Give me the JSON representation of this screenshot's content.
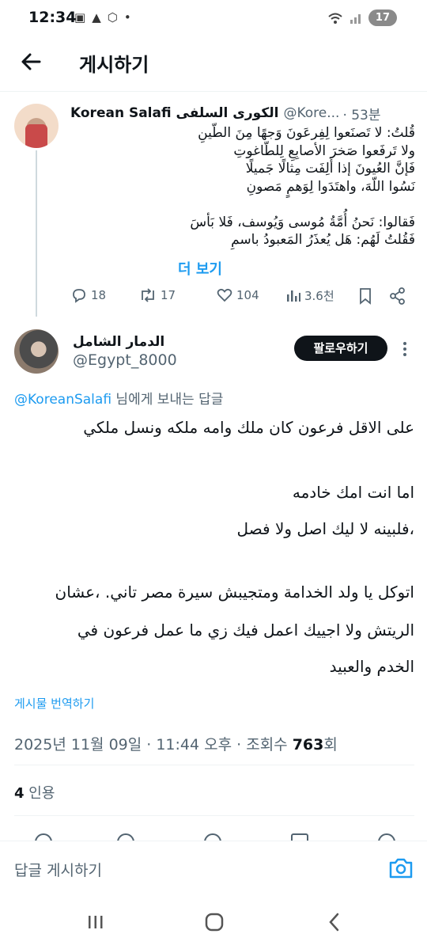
{
  "status_bar": {
    "time": "12:34",
    "battery": "17"
  },
  "header": {
    "title": "게시하기"
  },
  "original_tweet": {
    "name": "Korean Salafi الكورى السلفى",
    "handle": "@Kore...",
    "time": "· 53분",
    "body_lines": [
      "قُلتُ: لا تَصنَعوا لِفِرعَونَ وَجهًا مِنَ الطّينِ",
      "ولا تَرفَعوا صَخرَ الأصابِعِ لِلطّاغوتِ",
      "فَإنَّ العُيونَ إذا أَلِفَت مِثالًا جَميلًا",
      "نَسُوا اللّهَ، واهتَدَوا لِوَهمٍ مَصونِ",
      "",
      "فَقالوا: نَحنُ أُمَّةُ مُوسى وَيُوسف، فَلا بَأسَ",
      "فَقُلتُ لَهُم: هَل يُعذَرُ المَعبودُ باسمِ"
    ],
    "show_more": "더 보기",
    "replies": "18",
    "reposts": "17",
    "likes": "104",
    "views": "3.6천"
  },
  "reply_tweet": {
    "name": "الدمار الشامل",
    "handle": "@Egypt_8000",
    "follow_label": "팔로우하기",
    "reply_to_mention": "@KoreanSalafi",
    "reply_to_suffix": " 님에게 보내는 답글",
    "body_lines": [
      "على الاقل فرعون كان ملك وامه ملكه ونسل ملكي",
      "اما انت امك خادمه",
      "،فلبينه  لا ليك اصل ولا فصل",
      "اتوكل يا ولد الخدامة ومتجيبش سيرة مصر تاني. ،عشان",
      "الريتش ولا اجييك اعمل فيك زي ما عمل فرعون في",
      "الخدم والعبيد"
    ],
    "translate_label": "게시물 번역하기",
    "timestamp": "2025년 11월 09일 · 11:44 오후 · 조회수 ",
    "views_count": "763",
    "views_suffix": "회",
    "quote_count": "4",
    "quote_label": " 인용"
  },
  "composer": {
    "placeholder": "답글 게시하기"
  },
  "icons": {
    "back": "arrow-left-icon",
    "camera": "camera-icon",
    "reply": "reply-icon",
    "repost": "repost-icon",
    "like": "heart-icon",
    "views": "bar-chart-icon",
    "bookmark": "bookmark-icon",
    "share": "share-icon",
    "more": "more-icon"
  },
  "colors": {
    "accent": "#1d9bf0",
    "text": "#0f1419",
    "secondary": "#536471"
  }
}
